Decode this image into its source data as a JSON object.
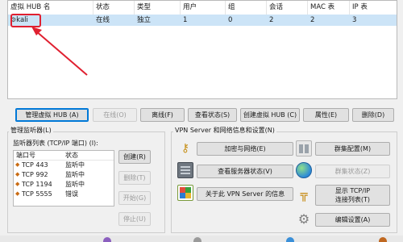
{
  "hub_table": {
    "columns": [
      "虚拟 HUB 名",
      "状态",
      "类型",
      "用户",
      "组",
      "会话",
      "MAC 表",
      "IP 表"
    ],
    "rows": [
      {
        "name": "kali",
        "status": "在线",
        "type": "独立",
        "users": "1",
        "groups": "0",
        "sessions": "2",
        "mac": "2",
        "ip": "3"
      }
    ],
    "annotation_color": "#e02030"
  },
  "buttons": {
    "manage_hub": "管理虚拟 HUB (A)",
    "online": "在线(O)",
    "offline": "离线(F)",
    "view_status": "查看状态(S)",
    "create_hub": "创建虚拟 HUB (C)",
    "properties": "属性(E)",
    "delete": "删除(D)"
  },
  "listener_manager": {
    "title": "管理监听器(L)",
    "list_label": "监听器列表 (TCP/IP 端口) (I):",
    "columns": [
      "端口号",
      "状态"
    ],
    "rows": [
      {
        "port": "TCP 443",
        "status": "监听中"
      },
      {
        "port": "TCP 992",
        "status": "监听中"
      },
      {
        "port": "TCP 1194",
        "status": "监听中"
      },
      {
        "port": "TCP 5555",
        "status": "错误"
      }
    ],
    "buttons": {
      "create": "创建(R)",
      "delete": "删除(T)",
      "start": "开始(G)",
      "stop": "停止(U)"
    }
  },
  "vpn_server": {
    "title": "VPN Server 和网络信息和设置(N)",
    "buttons": {
      "encryption": "加密与网络(E)",
      "cluster": "群集配置(M)",
      "server_status": "查看服务器状态(V)",
      "cluster_status": "群集状态(Z)",
      "about": "关于此 VPN Server 的信息",
      "tcpip_line1": "显示 TCP/IP",
      "tcpip_line2": "连接列表(T)",
      "edit_config": "编辑设置(A)"
    },
    "icons": [
      "key-icon",
      "server-icon",
      "info-icon",
      "cluster-icon",
      "globe-icon",
      "pipe-icon",
      "gear-icon"
    ]
  },
  "colors": {
    "selection": "#cce4f7",
    "primary_border": "#0078d7"
  }
}
